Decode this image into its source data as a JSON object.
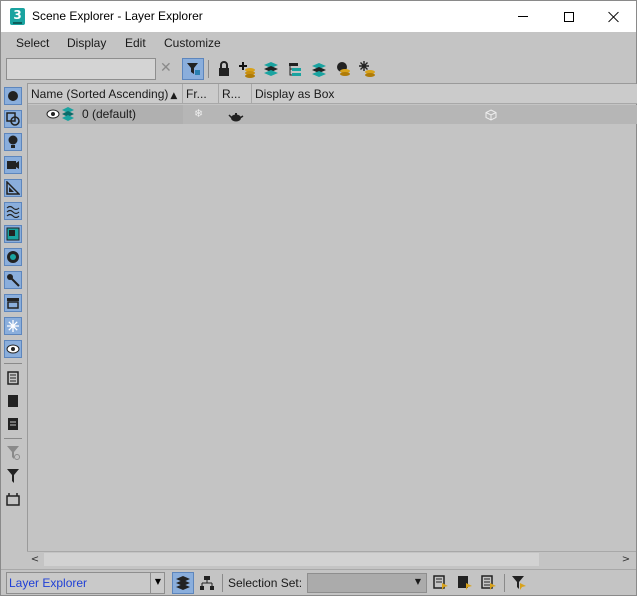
{
  "window": {
    "title": "Scene Explorer - Layer Explorer",
    "app_icon_glyph": "3",
    "controls": [
      "minimize",
      "maximize",
      "close"
    ]
  },
  "menu": [
    "Select",
    "Display",
    "Edit",
    "Customize"
  ],
  "toolbar": {
    "search_value": "",
    "icons": [
      "clear-search-icon",
      "filter-active-icon",
      "lock-icon",
      "add-to-layer-icon",
      "layers-stack-icon",
      "hierarchy-icon",
      "layers-icon",
      "select-layer-icon",
      "freeze-layer-icon"
    ]
  },
  "left_filters": [
    "geometry-icon",
    "shapes-icon",
    "lights-icon",
    "cameras-icon",
    "helpers-icon",
    "space-warps-icon",
    "groups-icon",
    "xrefs-icon",
    "bones-icon",
    "containers-icon",
    "frozen-icon",
    "hidden-icon",
    "list-all-icon",
    "list-none-icon",
    "invert-icon",
    "filter-options-icon",
    "filter-icon",
    "save-icon"
  ],
  "table": {
    "columns": [
      "Name (Sorted Ascending)",
      "Fr...",
      "R...",
      "Display as Box"
    ],
    "sort_indicator": "▲",
    "rows": [
      {
        "name": "0 (default)",
        "visible": true,
        "frozen": false,
        "renderable": true,
        "display_as_box": false
      }
    ]
  },
  "scrollbar": {
    "left_arrow": "<",
    "right_arrow": ">"
  },
  "bottom": {
    "explorer_value": "Layer Explorer",
    "selection_set_label": "Selection Set:",
    "selection_set_value": ""
  },
  "colors": {
    "accent": "#8aaedc",
    "teal": "#1aa3a0",
    "link_blue": "#1f3fd6",
    "bg": "#c4c4c4"
  }
}
